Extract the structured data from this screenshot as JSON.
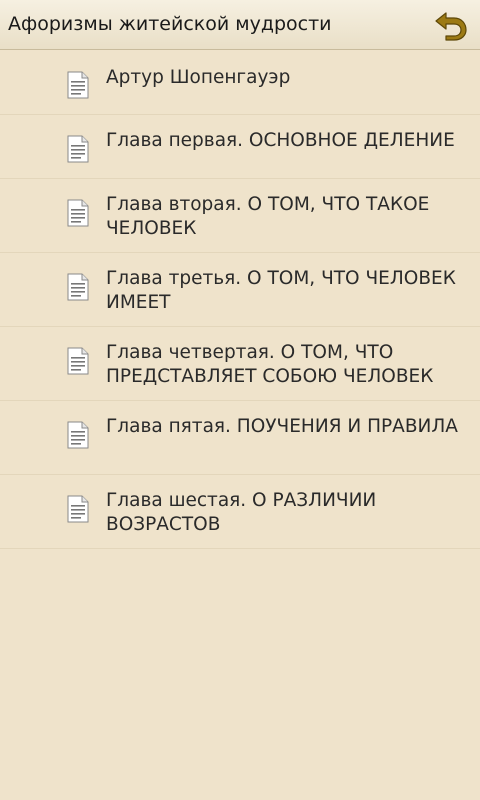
{
  "header": {
    "title": "Афоризмы житейской мудрости",
    "back_icon": "undo-arrow-icon",
    "accent_color": "#8a6a10"
  },
  "chapters": {
    "items": [
      {
        "label": "Артур Шопенгауэр",
        "icon": "document-icon"
      },
      {
        "label": "Глава первая. ОСНОВНОЕ ДЕЛЕНИЕ",
        "icon": "document-icon"
      },
      {
        "label": "Глава вторая. О ТОМ, ЧТО ТАКОЕ ЧЕЛОВЕК",
        "icon": "document-icon"
      },
      {
        "label": "Глава третья. О ТОМ, ЧТО ЧЕЛОВЕК ИМЕЕТ",
        "icon": "document-icon"
      },
      {
        "label": "Глава четвертая. О ТОМ, ЧТО ПРЕДСТАВЛЯЕТ СОБОЮ ЧЕЛОВЕК",
        "icon": "document-icon"
      },
      {
        "label": "Глава пятая. ПОУЧЕНИЯ И ПРАВИЛА",
        "icon": "document-icon"
      },
      {
        "label": "Глава шестая. О РАЗЛИЧИИ ВОЗРАСТОВ",
        "icon": "document-icon"
      }
    ]
  },
  "colors": {
    "background": "#efe3cb",
    "text": "#2a2a2a",
    "divider": "#e3d6bb"
  }
}
